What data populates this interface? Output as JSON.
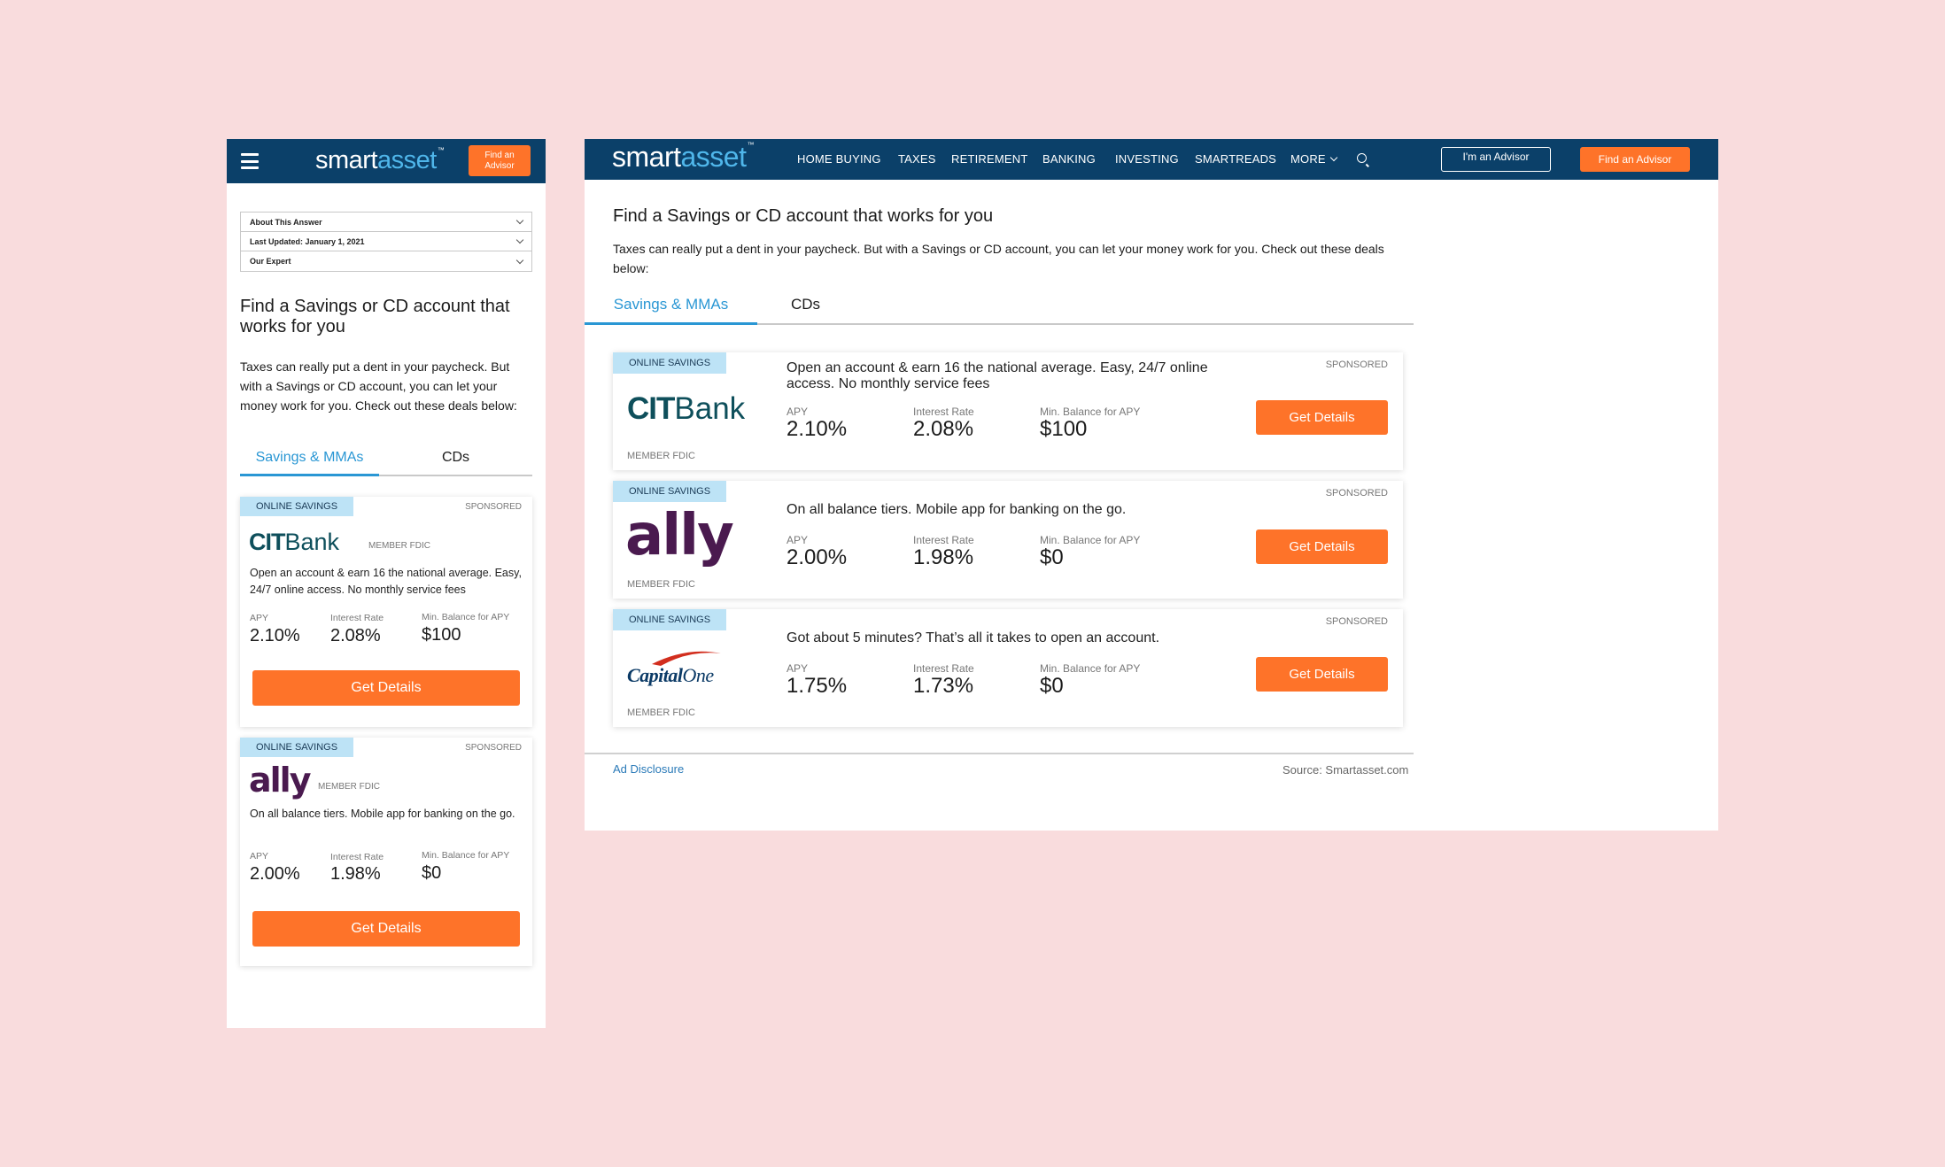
{
  "brand": {
    "logo_white": "smart",
    "logo_blue": "asset",
    "logo_tm": "™"
  },
  "mobile": {
    "find_advisor": "Find an Advisor",
    "find_advisor_line1": "Find an",
    "find_advisor_line2": "Advisor",
    "accordion": [
      "About This Answer",
      "Last Updated: January 1, 2021",
      "Our Expert"
    ],
    "title": "Find a Savings or CD account that works for you",
    "description": "Taxes can really put a dent in your paycheck. But with a Savings or CD account, you can let your money work for you. Check out these deals below:",
    "tabs": [
      "Savings & MMAs",
      "CDs"
    ],
    "cards": [
      {
        "tag": "ONLINE SAVINGS",
        "sponsored": "SPONSORED",
        "brand_a": "CIT",
        "brand_b": "Bank",
        "member": "MEMBER FDIC",
        "text": "Open an account & earn 16 the national average. Easy, 24/7 online access. No monthly service fees",
        "labels": [
          "APY",
          "Interest Rate",
          "Min. Balance for APY"
        ],
        "values": [
          "2.10%",
          "2.08%",
          "$100"
        ],
        "button": "Get Details"
      },
      {
        "tag": "ONLINE SAVINGS",
        "sponsored": "SPONSORED",
        "brand_a": "ally",
        "member": "MEMBER FDIC",
        "text": "On all balance tiers. Mobile app for banking on the go.",
        "labels": [
          "APY",
          "Interest Rate",
          "Min. Balance for APY"
        ],
        "values": [
          "2.00%",
          "1.98%",
          "$0"
        ],
        "button": "Get Details"
      }
    ]
  },
  "desktop": {
    "nav": [
      "HOME BUYING",
      "TAXES",
      "RETIREMENT",
      "BANKING",
      "INVESTING",
      "SMARTREADS",
      "MORE"
    ],
    "advisor_button": "I'm an Advisor",
    "find_advisor": "Find an Advisor",
    "title": "Find a Savings or CD account that works for you",
    "description": "Taxes can really put a dent in your paycheck. But with a Savings or CD account, you can let your money work for you. Check out these deals below:",
    "tabs": [
      "Savings & MMAs",
      "CDs"
    ],
    "cards": [
      {
        "tag": "ONLINE SAVINGS",
        "sponsored": "SPONSORED",
        "brand_a": "CIT",
        "brand_b": "Bank",
        "member": "MEMBER FDIC",
        "text": "Open an account & earn 16 the national average. Easy, 24/7 online access. No monthly service fees",
        "labels": [
          "APY",
          "Interest Rate",
          "Min. Balance for APY"
        ],
        "values": [
          "2.10%",
          "2.08%",
          "$100"
        ],
        "button": "Get Details"
      },
      {
        "tag": "ONLINE SAVINGS",
        "sponsored": "SPONSORED",
        "brand_a": "ally",
        "member": "MEMBER FDIC",
        "text": "On all balance tiers. Mobile app for banking on the go.",
        "labels": [
          "APY",
          "Interest Rate",
          "Min. Balance for APY"
        ],
        "values": [
          "2.00%",
          "1.98%",
          "$0"
        ],
        "button": "Get Details"
      },
      {
        "tag": "ONLINE SAVINGS",
        "sponsored": "SPONSORED",
        "brand_a": "Capital",
        "brand_b": "One",
        "member": "MEMBER FDIC",
        "text": "Got about 5 minutes? That’s all it takes to open an account.",
        "labels": [
          "APY",
          "Interest Rate",
          "Min. Balance for APY"
        ],
        "values": [
          "1.75%",
          "1.73%",
          "$0"
        ],
        "button": "Get Details"
      }
    ],
    "ad_disclosure": "Ad Disclosure",
    "source": "Source: Smartasset.com"
  },
  "colors": {
    "navy": "#0b4069",
    "orange": "#fe7329",
    "accent_blue": "#2a97d4",
    "tag_bg": "#bde3f6",
    "background": "#f9dcdd"
  },
  "icons": [
    "hamburger-icon",
    "search-icon",
    "chevron-down-icon"
  ]
}
